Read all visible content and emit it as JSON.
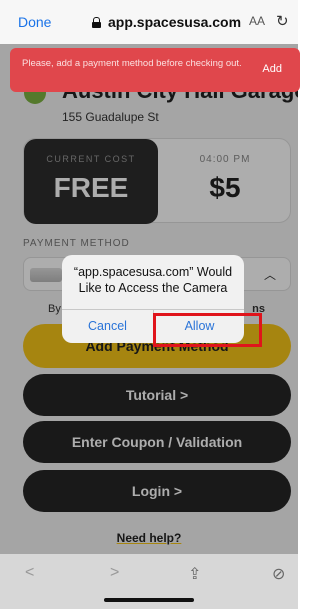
{
  "browser": {
    "done_label": "Done",
    "url": "app.spacesusa.com",
    "text_size_label": "AA",
    "reload_icon": "reload-icon"
  },
  "toast": {
    "message": "Please, add a payment method before checking out.",
    "action_label": "Add"
  },
  "garage": {
    "name": "Austin City Hall Garage",
    "address": "155 Guadalupe St"
  },
  "cost": {
    "current_label": "CURRENT COST",
    "current_value": "FREE",
    "next_time_label": "04:00 PM",
    "next_value": "$5"
  },
  "payment": {
    "label": "PAYMENT METHOD",
    "by_text": "By",
    "terms_text": "ns",
    "add_button_label": "Add Payment Method"
  },
  "actions": {
    "tutorial_label": "Tutorial >",
    "coupon_label": "Enter Coupon / Validation",
    "login_label": "Login >",
    "need_help_label": "Need help?"
  },
  "dialog": {
    "title": "“app.spacesusa.com” Would Like to Access the Camera",
    "cancel_label": "Cancel",
    "allow_label": "Allow"
  },
  "colors": {
    "accent_yellow": "#f5c518",
    "toast_red": "#e0474c",
    "highlight_red": "#e0141b",
    "ios_blue": "#2a74d8"
  }
}
